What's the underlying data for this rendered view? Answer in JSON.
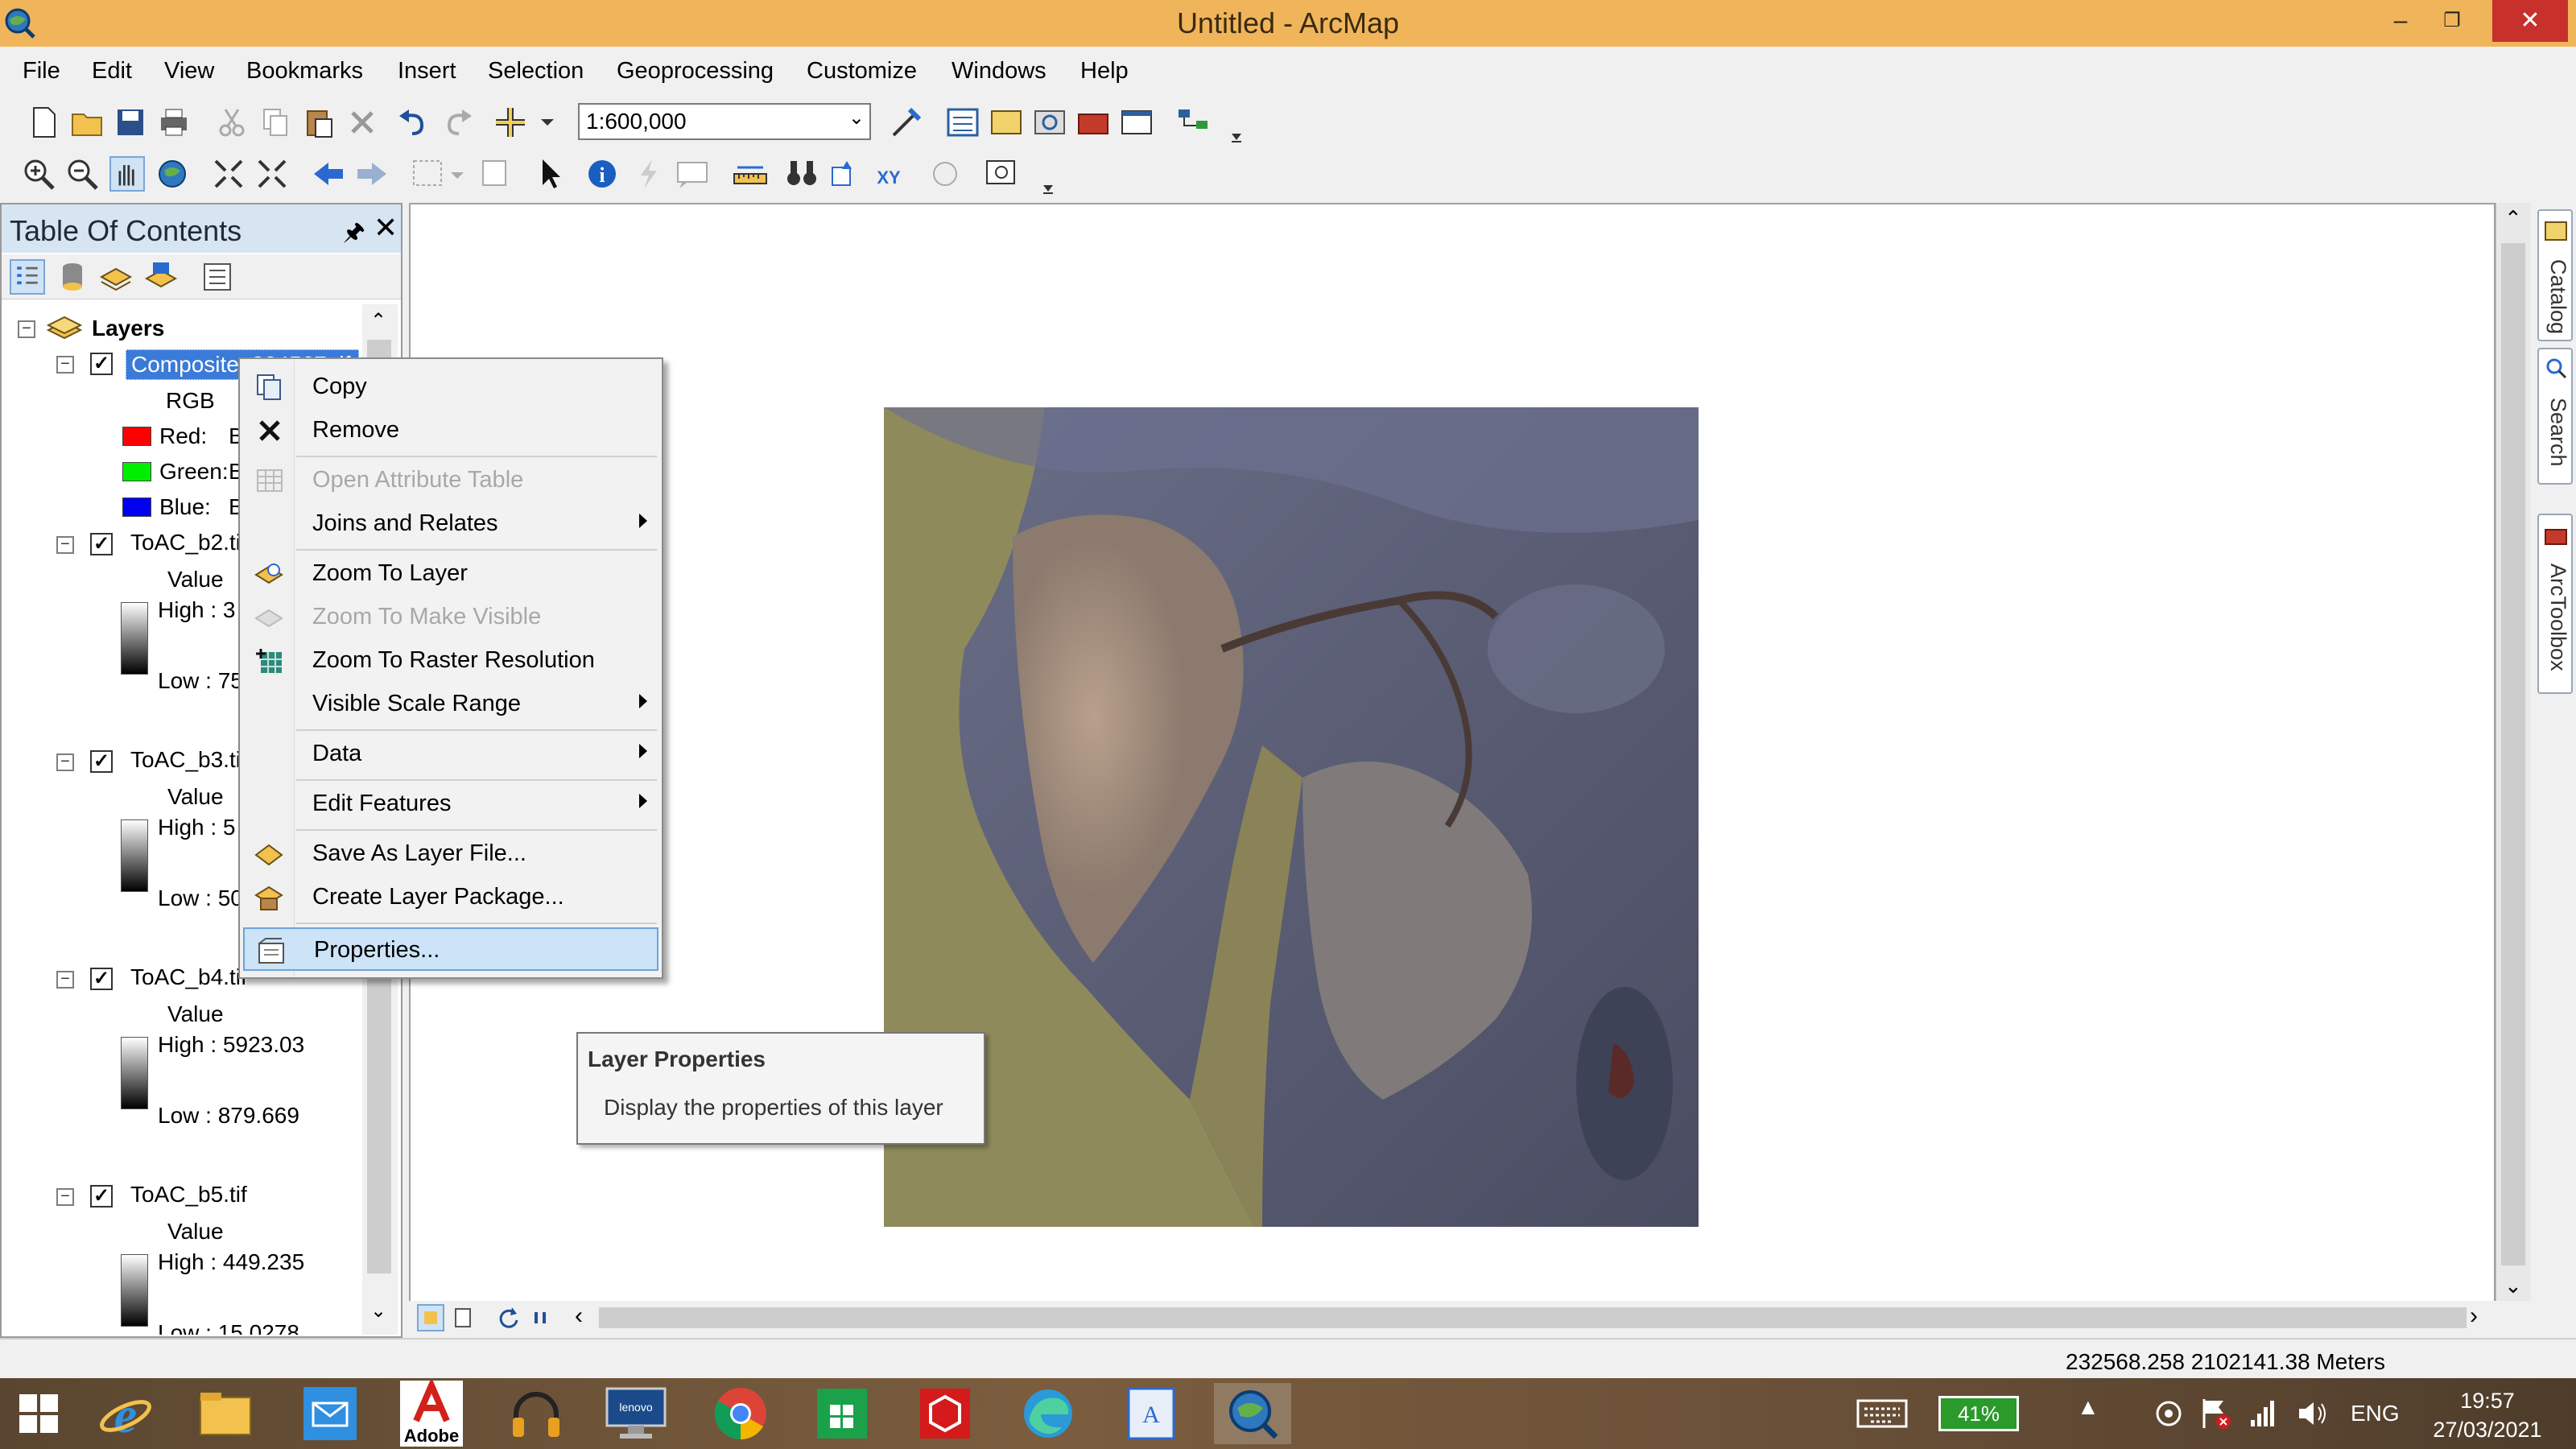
{
  "window": {
    "title": "Untitled - ArcMap",
    "minimize": "–",
    "maximize": "❐",
    "close": "✕"
  },
  "menu": [
    "File",
    "Edit",
    "View",
    "Bookmarks",
    "Insert",
    "Selection",
    "Geoprocessing",
    "Customize",
    "Windows",
    "Help"
  ],
  "toolbar": {
    "scale_value": "1:600,000"
  },
  "toc": {
    "title": "Table Of Contents",
    "root": "Layers",
    "layers": [
      {
        "name": "Composite_224567.tif",
        "checked": true,
        "legend_type": "RGB",
        "bands": [
          {
            "label": "Red:",
            "value": "B",
            "color": "#ff0000"
          },
          {
            "label": "Green:",
            "value": "B",
            "color": "#00ee00"
          },
          {
            "label": "Blue:",
            "value": "B",
            "color": "#0000ee"
          }
        ]
      },
      {
        "name": "ToAC_b2.tif",
        "checked": true,
        "value_label": "Value",
        "high": "High : 3",
        "low": "Low : 75"
      },
      {
        "name": "ToAC_b3.tif",
        "checked": true,
        "value_label": "Value",
        "high": "High : 5",
        "low": "Low : 50"
      },
      {
        "name": "ToAC_b4.tif",
        "checked": true,
        "value_label": "Value",
        "high": "High : 5923.03",
        "low": "Low : 879.669"
      },
      {
        "name": "ToAC_b5.tif",
        "checked": true,
        "value_label": "Value",
        "high": "High : 449.235",
        "low": "Low : 15.0278"
      }
    ]
  },
  "context_menu": {
    "items": [
      {
        "label": "Copy",
        "enabled": true,
        "submenu": false,
        "icon": "copy-icon"
      },
      {
        "label": "Remove",
        "enabled": true,
        "submenu": false,
        "icon": "remove-x-icon"
      },
      {
        "label": "Open Attribute Table",
        "enabled": false,
        "submenu": false,
        "icon": "table-icon"
      },
      {
        "label": "Joins and Relates",
        "enabled": true,
        "submenu": true,
        "icon": ""
      },
      {
        "label": "Zoom To Layer",
        "enabled": true,
        "submenu": false,
        "icon": "zoom-layer-icon"
      },
      {
        "label": "Zoom To Make Visible",
        "enabled": false,
        "submenu": false,
        "icon": "zoom-visible-icon"
      },
      {
        "label": "Zoom To Raster Resolution",
        "enabled": true,
        "submenu": false,
        "icon": "raster-resolution-icon"
      },
      {
        "label": "Visible Scale Range",
        "enabled": true,
        "submenu": true,
        "icon": ""
      },
      {
        "label": "Data",
        "enabled": true,
        "submenu": true,
        "icon": ""
      },
      {
        "label": "Edit Features",
        "enabled": true,
        "submenu": true,
        "icon": ""
      },
      {
        "label": "Save As Layer File...",
        "enabled": true,
        "submenu": false,
        "icon": "layer-file-icon"
      },
      {
        "label": "Create Layer Package...",
        "enabled": true,
        "submenu": false,
        "icon": "layer-package-icon"
      },
      {
        "label": "Properties...",
        "enabled": true,
        "submenu": false,
        "icon": "properties-icon",
        "selected": true
      }
    ]
  },
  "tooltip": {
    "title": "Layer Properties",
    "body": "Display the properties of this layer"
  },
  "side_tabs": [
    "Catalog",
    "Search",
    "ArcToolbox"
  ],
  "status": {
    "coordinates": "232568.258  2102141.38 Meters"
  },
  "taskbar": {
    "apps": [
      "windows-start",
      "internet-explorer",
      "file-explorer",
      "mail",
      "adobe-reader",
      "headphones-app",
      "lenovo",
      "chrome",
      "store",
      "red-cube-app",
      "edge",
      "text-app",
      "arcmap"
    ],
    "adobe_label": "Adobe",
    "battery": "41%",
    "language": "ENG",
    "time": "19:57",
    "date": "27/03/2021"
  }
}
